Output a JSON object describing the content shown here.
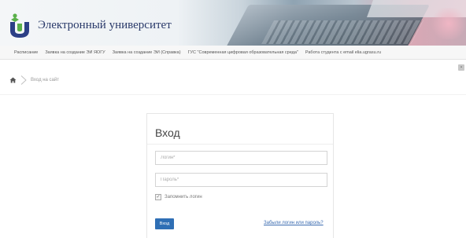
{
  "header": {
    "site_title": "Электронный университет",
    "logo_icon": "university-logo-icon"
  },
  "topnav": {
    "items": [
      "Расписание",
      "Заявка на создание ЭИ ЯОГУ",
      "Заявка на создание ЭИ (Справка)",
      "ГУС \"Современная цифровая образовательная среда\"",
      "Работа студента с email elia.ugrasu.ru"
    ]
  },
  "breadcrumb": {
    "home_icon": "home-icon",
    "current": "Вход на сайт"
  },
  "login": {
    "title": "Вход",
    "username_placeholder": "Логин*",
    "password_placeholder": "Пароль*",
    "remember_label": "Запомнить логин",
    "remember_checked": true,
    "submit_label": "Вход",
    "forgot_link": "Забыли логин или пароль?"
  },
  "colors": {
    "accent": "#2f6fb5",
    "title": "#2a3a6a",
    "link": "#3a6bb0"
  }
}
